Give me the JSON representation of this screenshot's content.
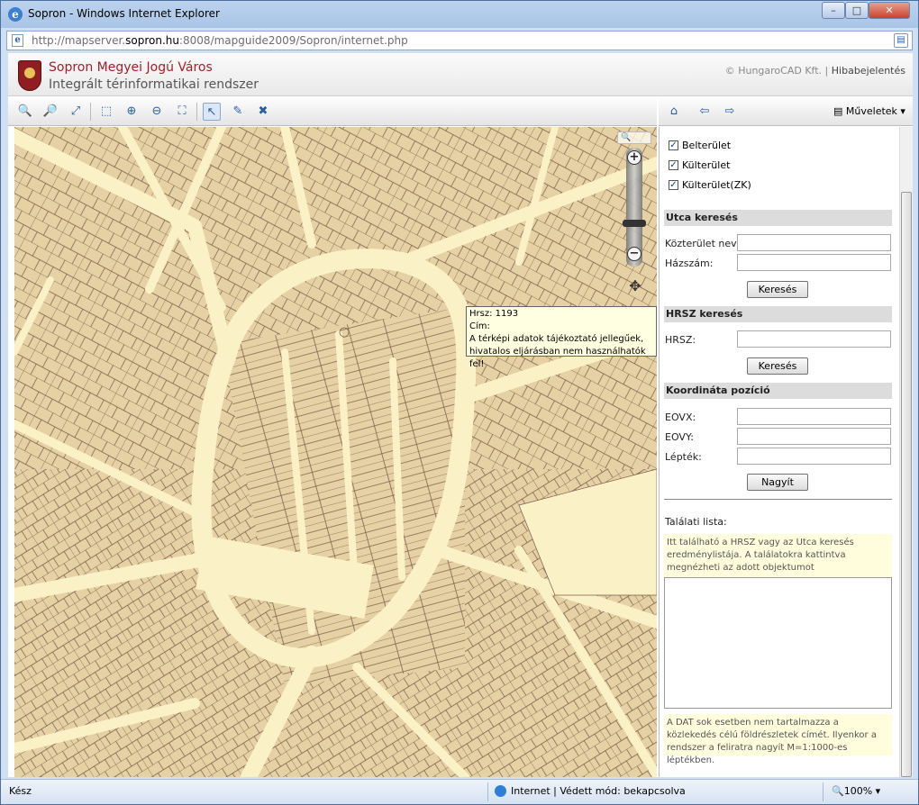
{
  "window": {
    "title": "Sopron - Windows Internet Explorer",
    "min": "–",
    "max": "□",
    "close": "✕"
  },
  "address": {
    "url_prefix": "http://mapserver.",
    "url_host": "sopron.hu",
    "url_rest": ":8008/mapguide2009/Sopron/internet.php"
  },
  "header": {
    "title": "Sopron Megyei Jogú Város",
    "subtitle": "Integrált térinformatikai rendszer",
    "copyright": "© HungaroCAD Kft.",
    "separator": "|",
    "report": "Hibabejelentés"
  },
  "toolbar": {
    "items": [
      {
        "name": "zoom-in-tool-icon",
        "glyph": "🔍"
      },
      {
        "name": "zoom-out-tool-icon",
        "glyph": "🔎"
      },
      {
        "name": "zoom-extents-icon",
        "glyph": "⤢"
      },
      {
        "name": "zoom-window-icon",
        "glyph": "⬚"
      },
      {
        "name": "zoom-in-icon",
        "glyph": "⊕"
      },
      {
        "name": "zoom-out-icon",
        "glyph": "⊖"
      },
      {
        "name": "zoom-selection-icon",
        "glyph": "⛶"
      },
      {
        "name": "select-pointer-icon",
        "glyph": "↖"
      },
      {
        "name": "select-radius-icon",
        "glyph": "✎"
      },
      {
        "name": "clear-selection-icon",
        "glyph": "✖"
      }
    ]
  },
  "rtoolbar": {
    "home": "⌂",
    "back": "⇦",
    "forward": "⇨",
    "menu_icon": "▤",
    "menu_label": "Műveletek",
    "menu_arrow": "▾"
  },
  "map": {
    "search_icon": "🔍",
    "zoom_in": "+",
    "zoom_out": "−",
    "pan": "✥"
  },
  "tooltip": {
    "line1": "Hrsz: 1193",
    "line2": "Cím:",
    "line3": "A térképi adatok tájékoztató jellegűek,",
    "line4": "hivatalos eljárásban nem használhatók fel!"
  },
  "layers": [
    {
      "label": "Belterület",
      "checked": "✓"
    },
    {
      "label": "Külterület",
      "checked": "✓"
    },
    {
      "label": "Külterület(ZK)",
      "checked": "✓"
    }
  ],
  "street_search": {
    "title": "Utca keresés",
    "street_label": "Közterület neve:",
    "house_label": "Házszám:",
    "button": "Keresés"
  },
  "hrsz_search": {
    "title": "HRSZ keresés",
    "hrsz_label": "HRSZ:",
    "button": "Keresés"
  },
  "coord": {
    "title": "Koordináta pozíció",
    "eovx": "EOVX:",
    "eovy": "EOVY:",
    "scale": "Lépték:",
    "button": "Nagyít"
  },
  "results": {
    "label": "Találati lista:",
    "hint": "Itt található a HRSZ vagy az Utca keresés eredménylistája. A találatokra kattintva megnézheti az adott objektumot",
    "footnote": "A DAT sok esetben nem tartalmazza a közlekedés célú földrészletek címét. Ilyenkor a rendszer a feliratra nagyít M=1:1000-es léptékben."
  },
  "status": {
    "left": "Kész",
    "zone": "Internet | Védett mód: bekapcsolva",
    "zoom": "🔍100% ▾"
  },
  "colors": {
    "parcel": "#e5d1a3",
    "street": "#fbf1c7",
    "line": "#7a5a4a"
  }
}
